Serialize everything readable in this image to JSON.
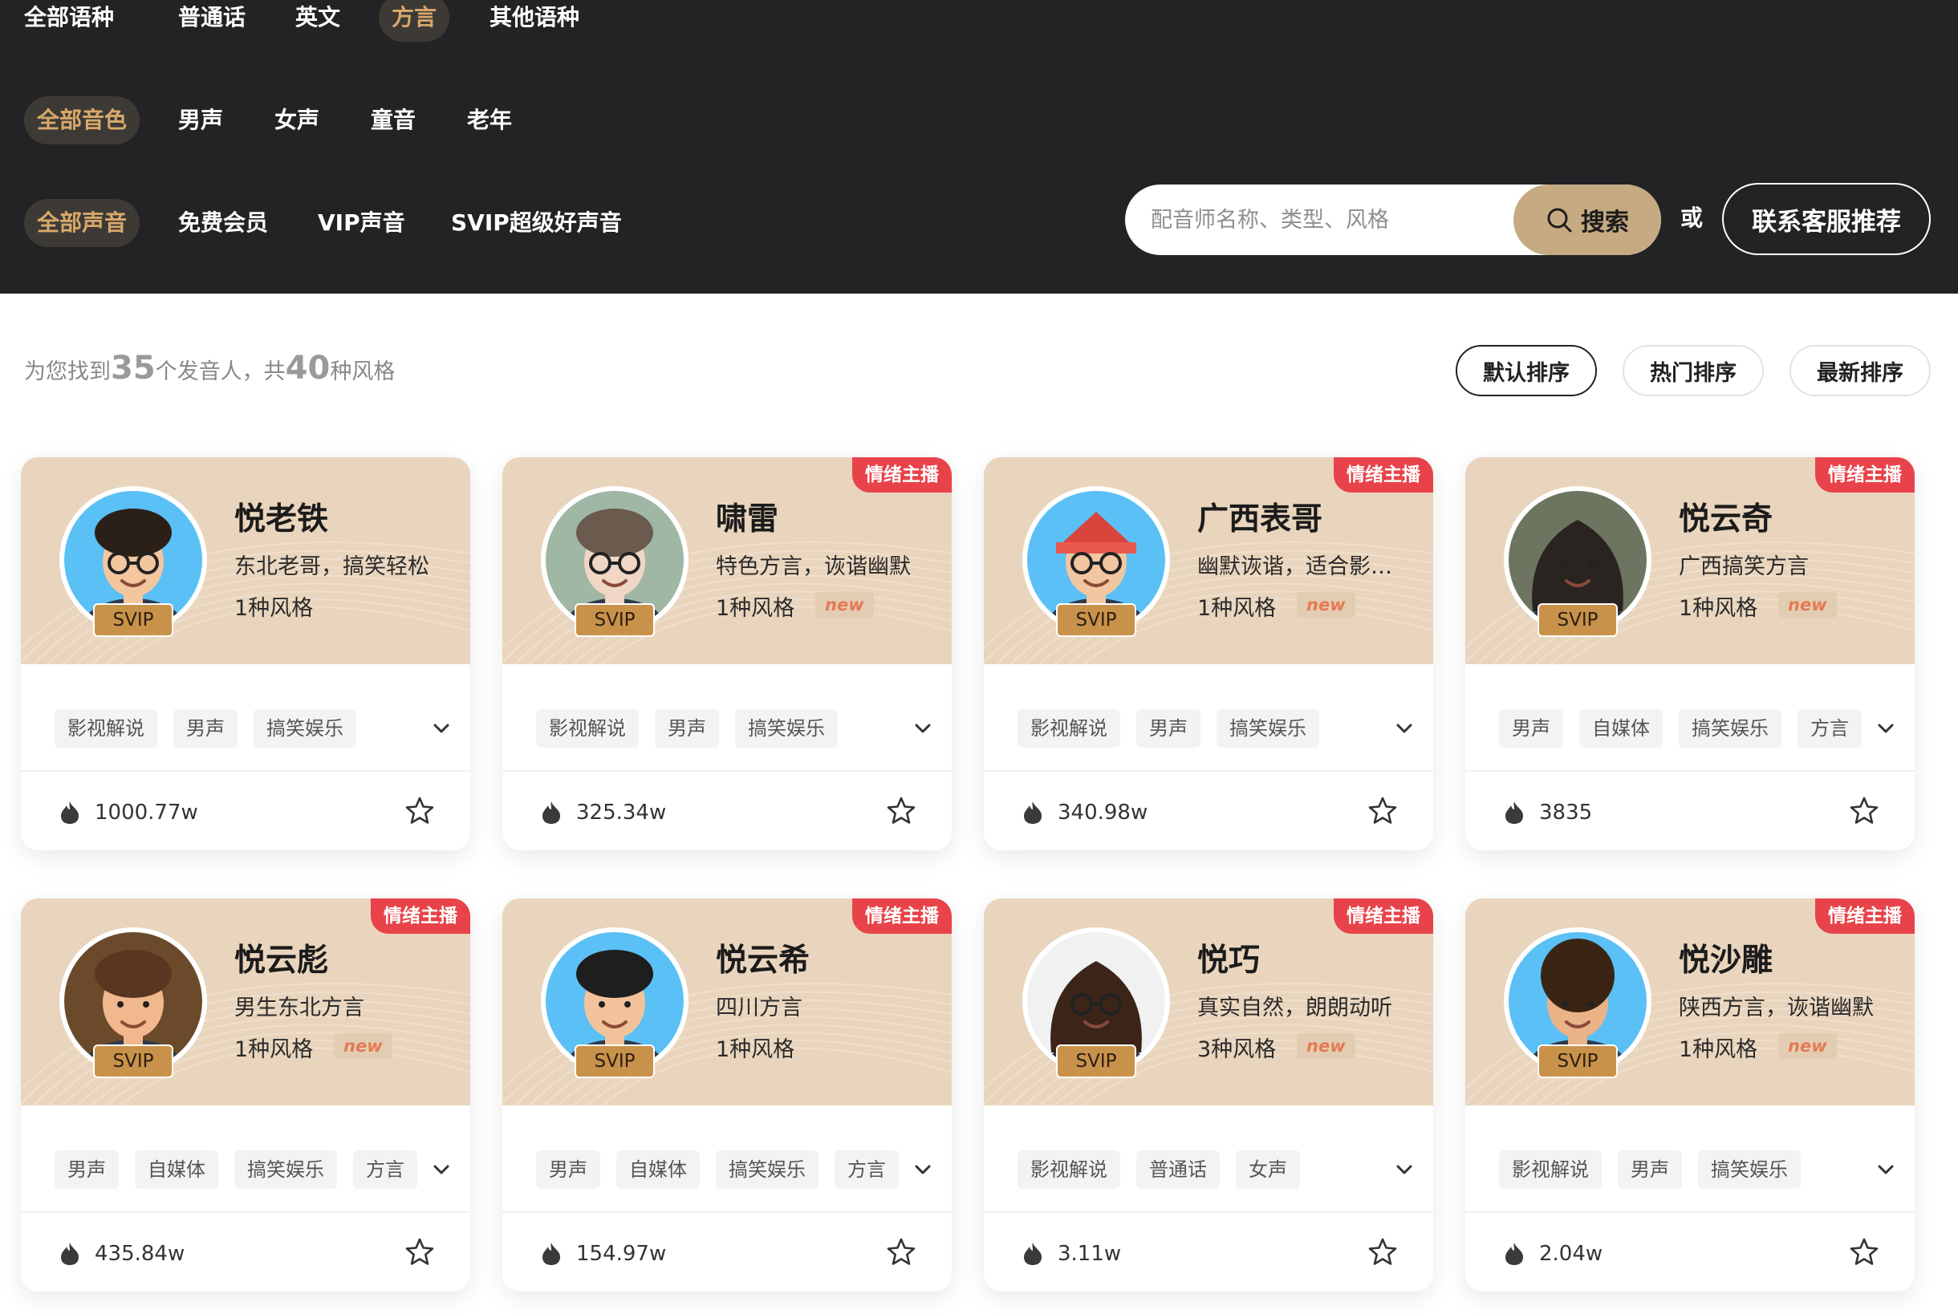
{
  "filters": {
    "language": [
      "全部语种",
      "普通话",
      "英文",
      "方言",
      "其他语种"
    ],
    "timbre": [
      "全部音色",
      "男声",
      "女声",
      "童音",
      "老年"
    ],
    "membership": [
      "全部声音",
      "免费会员",
      "VIP声音",
      "SVIP超级好声音"
    ]
  },
  "search": {
    "placeholder": "配音师名称、类型、风格",
    "button_label": "搜索",
    "or_text": "或",
    "contact_label": "联系客服推荐"
  },
  "results": {
    "prefix": "为您找到",
    "speaker_count": "35",
    "middle": "个发音人，共",
    "style_count": "40",
    "suffix": "种风格"
  },
  "sort": [
    "默认排序",
    "热门排序",
    "最新排序"
  ],
  "cards": [
    {
      "name": "悦老铁",
      "desc": "东北老哥，搞笑轻松",
      "styles": "1种风格",
      "badge": "SVIP",
      "mood": "",
      "new": "",
      "tags": [
        "影视解说",
        "男声",
        "搞笑娱乐"
      ],
      "plays": "1000.77w"
    },
    {
      "name": "啸雷",
      "desc": "特色方言，诙谐幽默",
      "styles": "1种风格",
      "badge": "SVIP",
      "mood": "情绪主播",
      "new": "new",
      "tags": [
        "影视解说",
        "男声",
        "搞笑娱乐"
      ],
      "plays": "325.34w"
    },
    {
      "name": "广西表哥",
      "desc": "幽默诙谐，适合影视解说",
      "styles": "1种风格",
      "badge": "SVIP",
      "mood": "情绪主播",
      "new": "new",
      "tags": [
        "影视解说",
        "男声",
        "搞笑娱乐"
      ],
      "plays": "340.98w"
    },
    {
      "name": "悦云奇",
      "desc": "广西搞笑方言",
      "styles": "1种风格",
      "badge": "SVIP",
      "mood": "情绪主播",
      "new": "new",
      "tags": [
        "男声",
        "自媒体",
        "搞笑娱乐",
        "方言"
      ],
      "plays": "3835"
    },
    {
      "name": "悦云彪",
      "desc": "男生东北方言",
      "styles": "1种风格",
      "badge": "SVIP",
      "mood": "情绪主播",
      "new": "new",
      "tags": [
        "男声",
        "自媒体",
        "搞笑娱乐",
        "方言"
      ],
      "plays": "435.84w"
    },
    {
      "name": "悦云希",
      "desc": "四川方言",
      "styles": "1种风格",
      "badge": "SVIP",
      "mood": "情绪主播",
      "new": "",
      "tags": [
        "男声",
        "自媒体",
        "搞笑娱乐",
        "方言"
      ],
      "plays": "154.97w"
    },
    {
      "name": "悦巧",
      "desc": "真实自然，朗朗动听",
      "styles": "3种风格",
      "badge": "SVIP",
      "mood": "情绪主播",
      "new": "new",
      "tags": [
        "影视解说",
        "普通话",
        "女声"
      ],
      "plays": "3.11w"
    },
    {
      "name": "悦沙雕",
      "desc": "陕西方言，诙谐幽默",
      "styles": "1种风格",
      "badge": "SVIP",
      "mood": "情绪主播",
      "new": "new",
      "tags": [
        "影视解说",
        "男声",
        "搞笑娱乐"
      ],
      "plays": "2.04w"
    }
  ],
  "colors": {
    "header_bg": "#232325",
    "accent_gold": "#d8a86a",
    "search_button": "#c6aa82",
    "card_top": "#e9d5bd",
    "mood_tag": "#e8434a",
    "svip_badge": "#c9924a",
    "new_text": "#e57a56"
  },
  "icons": {
    "search_button": "magnifier-icon",
    "expand": "chevron-down-icon",
    "plays": "fire-icon",
    "favorite": "star-outline-icon"
  }
}
